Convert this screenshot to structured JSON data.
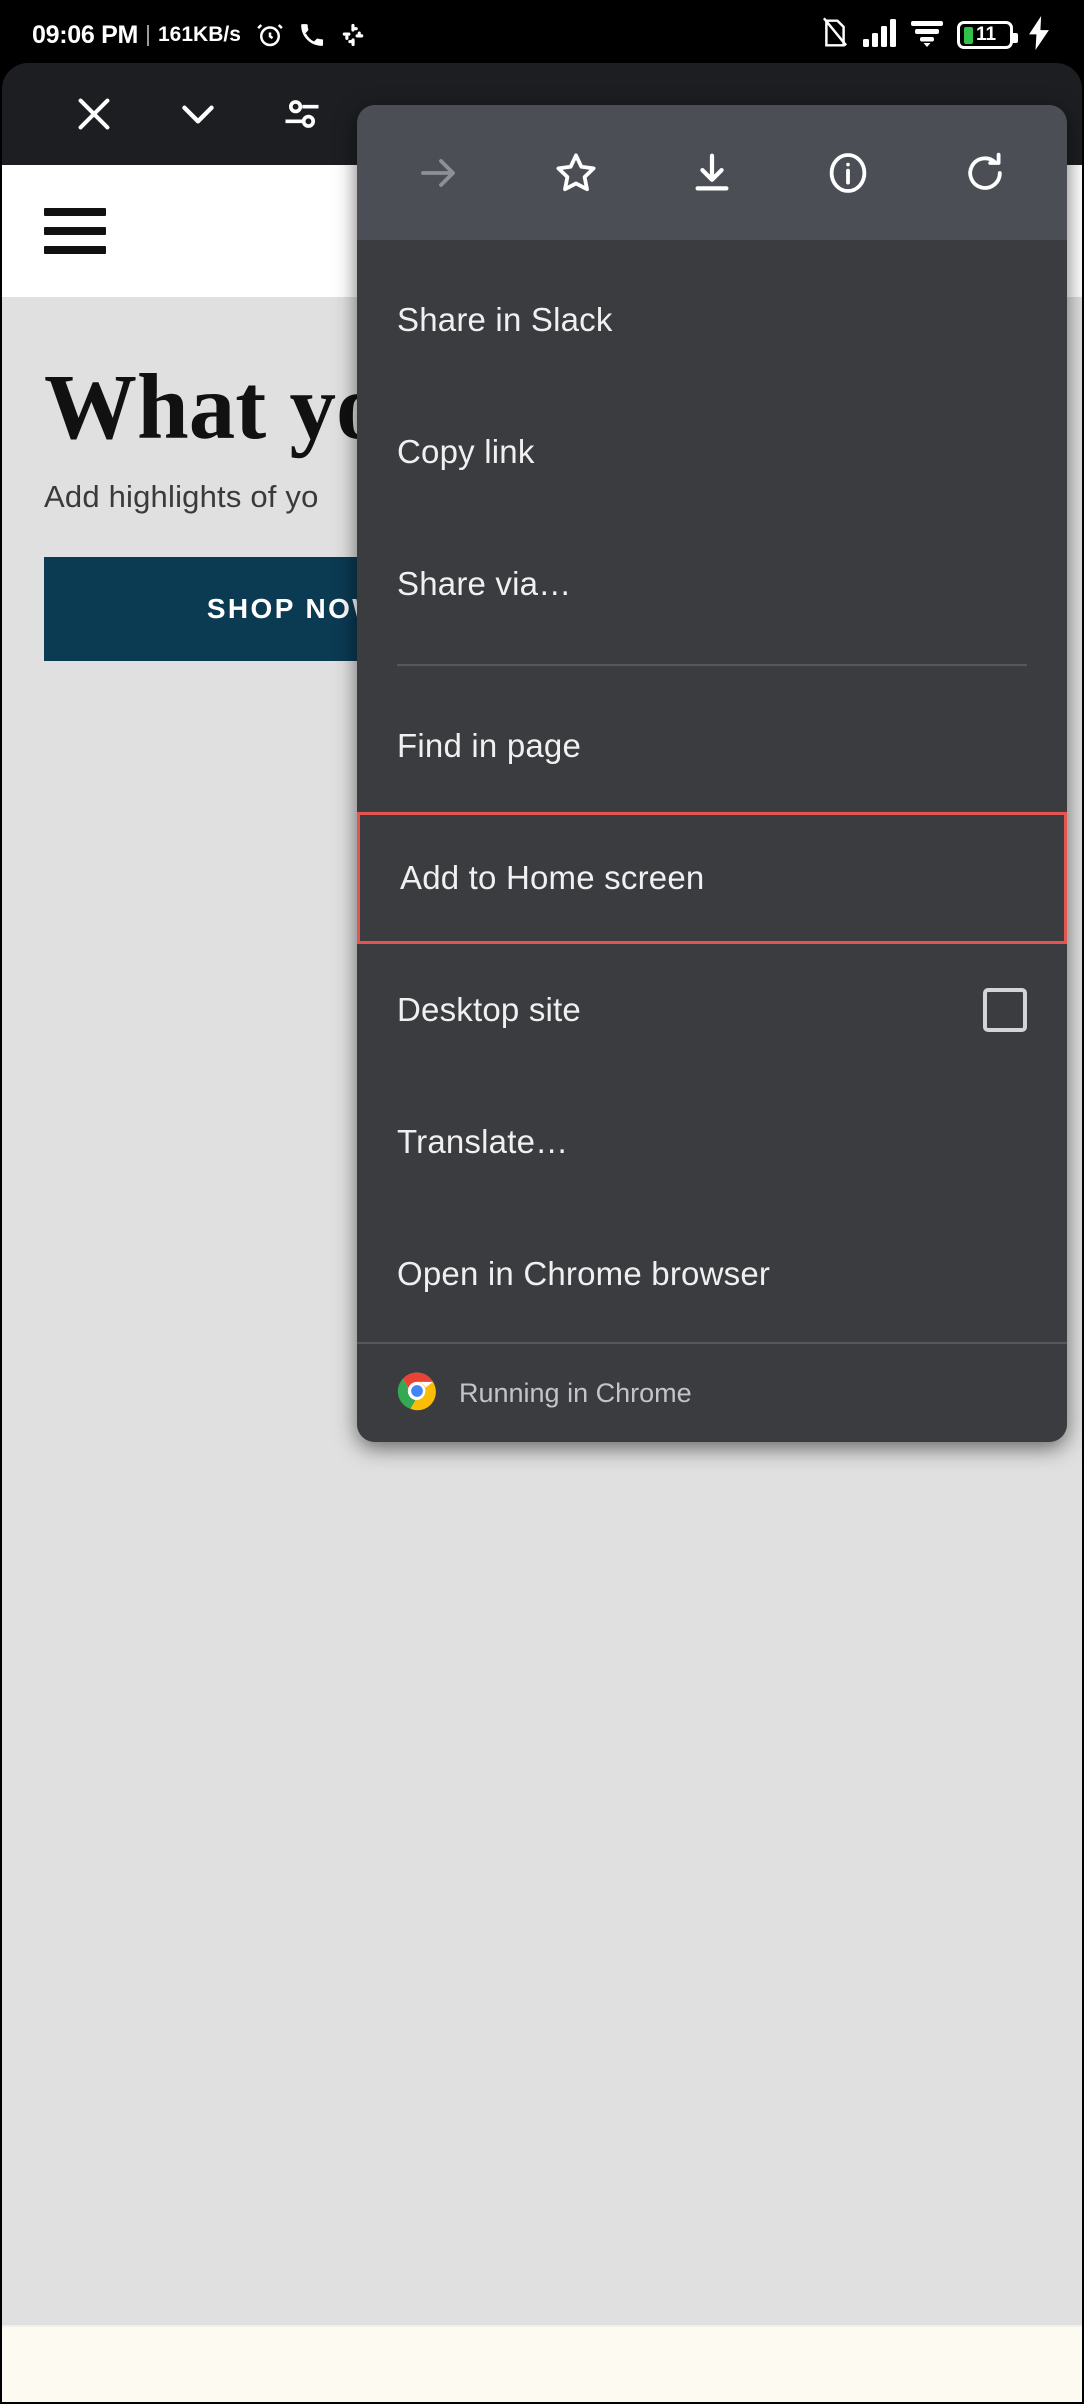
{
  "statusbar": {
    "time": "09:06 PM",
    "network_speed": "161KB/s",
    "icons": [
      "alarm-icon",
      "phone-call-icon",
      "slack-icon"
    ],
    "right_icons": [
      "no-sim-icon",
      "signal-bars-icon",
      "wifi-icon"
    ],
    "battery_percent": "11",
    "charging": true,
    "battery_color": "#31c24a"
  },
  "browser_bar": {
    "close_label": "close-icon",
    "collapse_label": "chevron-down-icon",
    "tune_label": "tune-icon"
  },
  "webpage": {
    "menu_button": "hamburger-menu-icon",
    "title": "What yo",
    "subtitle": "Add highlights of yo",
    "cta_label": "SHOP NOW",
    "cta_color": "#0b3a53",
    "background_color": "#e0e0e0",
    "footer_color": "#fdfaf2"
  },
  "menu": {
    "header_icons": [
      {
        "name": "forward-arrow-icon",
        "disabled": true
      },
      {
        "name": "bookmark-star-icon",
        "disabled": false
      },
      {
        "name": "download-icon",
        "disabled": false
      },
      {
        "name": "page-info-icon",
        "disabled": false
      },
      {
        "name": "refresh-icon",
        "disabled": false
      }
    ],
    "items": [
      {
        "label": "Share in Slack",
        "type": "action",
        "highlighted": false
      },
      {
        "label": "Copy link",
        "type": "action",
        "highlighted": false
      },
      {
        "label": "Share via…",
        "type": "action",
        "highlighted": false
      },
      {
        "label": "Find in page",
        "type": "action",
        "highlighted": false
      },
      {
        "label": "Add to Home screen",
        "type": "action",
        "highlighted": true
      },
      {
        "label": "Desktop site",
        "type": "checkbox",
        "checked": false,
        "highlighted": false
      },
      {
        "label": "Translate…",
        "type": "action",
        "highlighted": false
      },
      {
        "label": "Open in Chrome browser",
        "type": "action",
        "highlighted": false
      }
    ],
    "footer": {
      "icon": "chrome-logo-icon",
      "label": "Running in Chrome"
    },
    "highlight_color": "#e2564f",
    "background_color": "#3b3c40",
    "header_color": "#4b4e55"
  }
}
